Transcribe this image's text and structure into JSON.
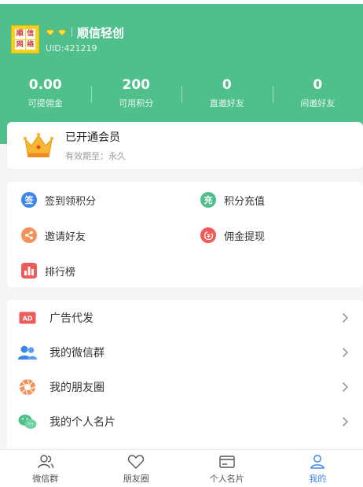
{
  "profile": {
    "avatar_text": [
      "順",
      "信",
      "网",
      "络"
    ],
    "nickname": "顺信轻创",
    "uid": "UID:421219"
  },
  "stats": [
    {
      "value": "0.00",
      "label": "可提佣金"
    },
    {
      "value": "200",
      "label": "可用积分"
    },
    {
      "value": "0",
      "label": "直邀好友"
    },
    {
      "value": "0",
      "label": "间邀好友"
    }
  ],
  "member": {
    "title": "已开通会员",
    "subtitle": "有效期至：永久"
  },
  "quick": [
    {
      "label": "签到领积分",
      "icon": "sign-icon",
      "glyph": "签",
      "color": "#3b86e8"
    },
    {
      "label": "积分充值",
      "icon": "recharge-icon",
      "glyph": "充",
      "color": "#4fbf8b"
    },
    {
      "label": "邀请好友",
      "icon": "share-icon",
      "glyph": "",
      "color": "#f5925a"
    },
    {
      "label": "佣金提现",
      "icon": "withdraw-icon",
      "glyph": "",
      "color": "#ef5a5a"
    },
    {
      "label": "排行榜",
      "icon": "ranking-icon",
      "glyph": "",
      "color": "#ef5a5a"
    }
  ],
  "menu": [
    {
      "label": "广告代发",
      "icon": "ad-icon",
      "badge": "AD"
    },
    {
      "label": "我的微信群",
      "icon": "group-icon"
    },
    {
      "label": "我的朋友圈",
      "icon": "moments-icon"
    },
    {
      "label": "我的个人名片",
      "icon": "wechat-icon"
    }
  ],
  "tabs": [
    {
      "label": "微信群",
      "icon": "users-icon"
    },
    {
      "label": "朋友圈",
      "icon": "heart-icon"
    },
    {
      "label": "个人名片",
      "icon": "card-icon"
    },
    {
      "label": "我的",
      "icon": "person-icon",
      "active": true
    }
  ],
  "colors": {
    "brand": "#4fbf8b",
    "active_tab": "#3b86e8"
  }
}
